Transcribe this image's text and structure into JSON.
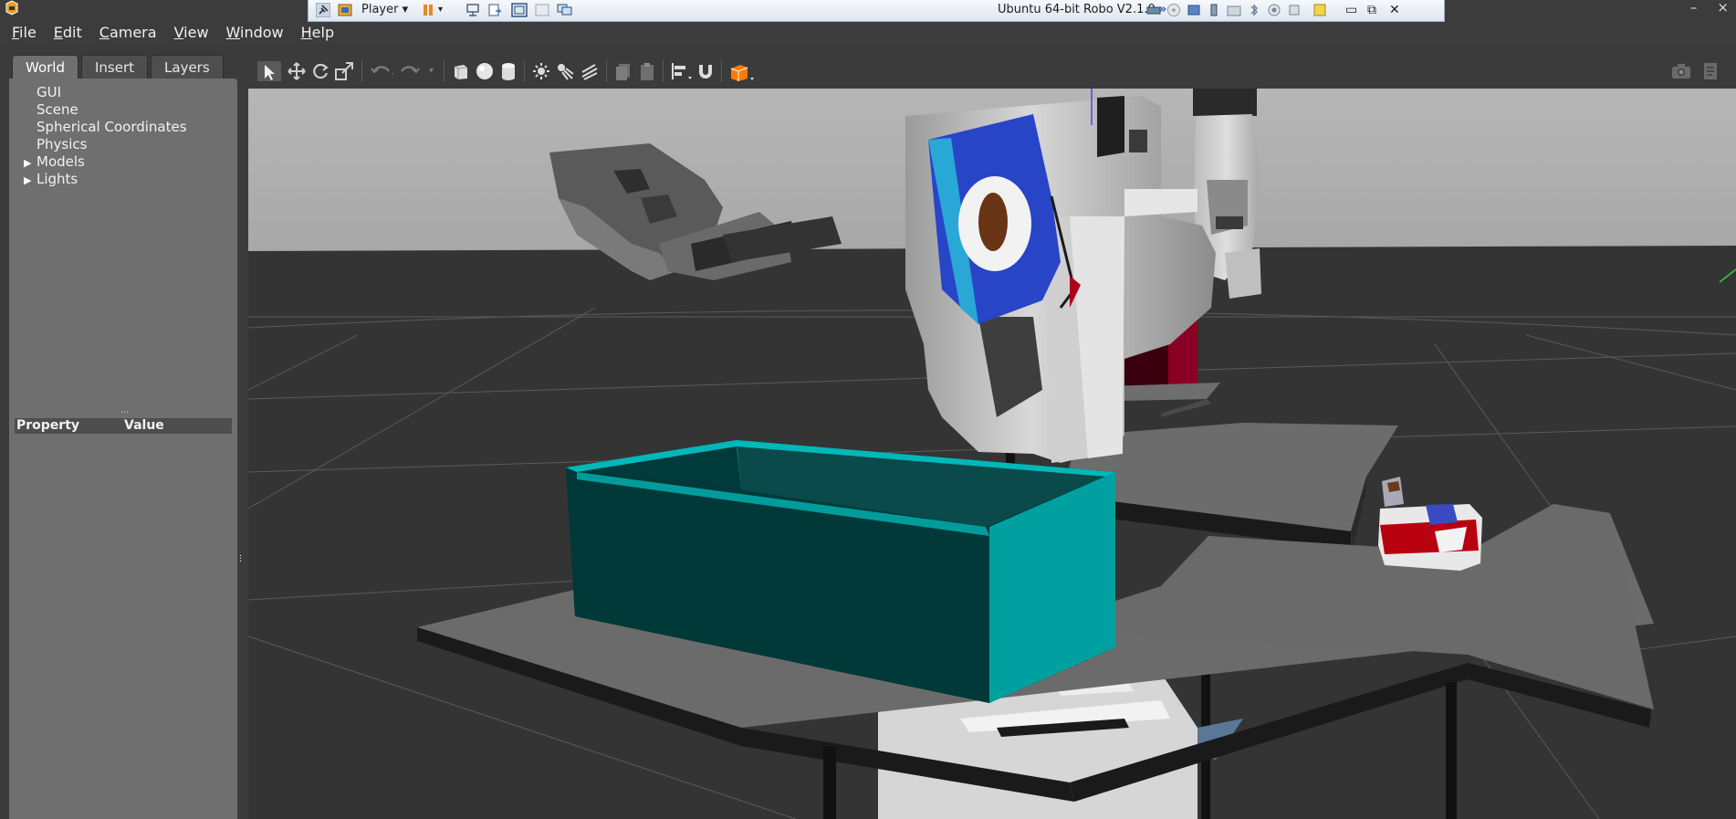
{
  "menu": {
    "items": [
      {
        "first": "F",
        "rest": "ile"
      },
      {
        "first": "E",
        "rest": "dit"
      },
      {
        "first": "C",
        "rest": "amera"
      },
      {
        "first": "V",
        "rest": "iew"
      },
      {
        "first": "W",
        "rest": "indow"
      },
      {
        "first": "H",
        "rest": "elp"
      }
    ]
  },
  "vbox": {
    "player_label": "Player",
    "vm_title": "Ubuntu 64-bit Robo V2.1.0",
    "chevron": "»"
  },
  "window_controls": {
    "minimize": "–",
    "close": "×"
  },
  "left_panel": {
    "tabs": [
      "World",
      "Insert",
      "Layers"
    ],
    "active_tab": "World",
    "tree": [
      {
        "label": "GUI",
        "expandable": false
      },
      {
        "label": "Scene",
        "expandable": false
      },
      {
        "label": "Spherical Coordinates",
        "expandable": false
      },
      {
        "label": "Physics",
        "expandable": false
      },
      {
        "label": "Models",
        "expandable": true
      },
      {
        "label": "Lights",
        "expandable": true
      }
    ],
    "property_header": {
      "property": "Property",
      "value": "Value"
    }
  },
  "toolbar": {
    "icons": [
      "select-arrow-icon",
      "translate-icon",
      "rotate-icon",
      "scale-icon",
      "undo-icon",
      "redo-icon",
      "box-shape-icon",
      "sphere-shape-icon",
      "cylinder-shape-icon",
      "point-light-icon",
      "spot-light-icon",
      "directional-light-icon",
      "copy-icon",
      "paste-icon",
      "align-icon",
      "magnet-icon",
      "view-angle-icon",
      "screenshot-icon",
      "log-icon"
    ]
  },
  "colors": {
    "background": "#3b3b3b",
    "panel": "#6f6f6f",
    "sky": "#b2b2b2",
    "ground": "#353535",
    "teal_bin": "#00a0a0",
    "red_bin": "#8a0024",
    "table_top": "#6a6a6a",
    "robot_white": "#d8d8d8",
    "accent_orange": "#ff7b00"
  }
}
